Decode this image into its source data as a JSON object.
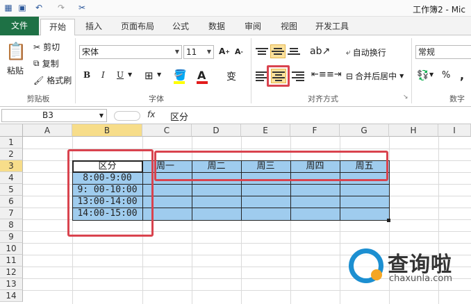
{
  "window": {
    "title": "工作簿2 - Mic"
  },
  "ribbon_tabs": [
    "文件",
    "开始",
    "插入",
    "页面布局",
    "公式",
    "数据",
    "审阅",
    "视图",
    "开发工具"
  ],
  "clipboard": {
    "paste": "粘贴",
    "cut": "剪切",
    "copy": "复制",
    "format_painter": "格式刷",
    "label": "剪贴板"
  },
  "font": {
    "name": "宋体",
    "size": "11",
    "bold": "B",
    "italic": "I",
    "underline": "U",
    "label": "字体"
  },
  "alignment": {
    "wrap_text": "自动换行",
    "merge_center": "合并后居中",
    "label": "对齐方式"
  },
  "number": {
    "format": "常规",
    "percent": "%",
    "comma": ",",
    "label": "数字"
  },
  "formula_bar": {
    "cell_ref": "B3",
    "fx": "fx",
    "content": "区分"
  },
  "columns": [
    "A",
    "B",
    "C",
    "D",
    "E",
    "F",
    "G",
    "H",
    "I"
  ],
  "rows": [
    "1",
    "2",
    "3",
    "4",
    "5",
    "6",
    "7",
    "8",
    "9",
    "10",
    "11",
    "12",
    "13",
    "14"
  ],
  "sheet": {
    "header": "区分",
    "days": [
      "周一",
      "周二",
      "周三",
      "周四",
      "周五"
    ],
    "times": [
      "8:00-9:00",
      "9: 00-10:00",
      "13:00-14:00",
      "14:00-15:00"
    ]
  },
  "watermark": {
    "brand": "查询啦",
    "url": "chaxunla.com"
  },
  "colors": {
    "file_tab": "#1e7145",
    "cell_fill": "#9fccee",
    "highlight": "#d9434e",
    "selected_header": "#f7dd8a"
  }
}
